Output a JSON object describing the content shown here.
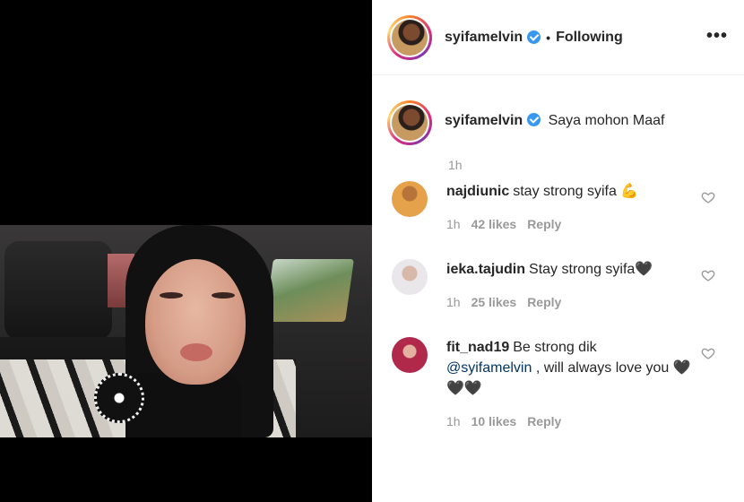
{
  "post": {
    "username": "syifamelvin",
    "follow_status": "Following",
    "separator": "•",
    "more_label": "•••"
  },
  "caption": {
    "username": "syifamelvin",
    "text": "Saya mohon Maaf",
    "time": "1h"
  },
  "comments": [
    {
      "username": "najdiunic",
      "text": "stay strong syifa 💪",
      "time": "1h",
      "likes": "42 likes",
      "reply": "Reply"
    },
    {
      "username": "ieka.tajudin",
      "text": "Stay strong syifa🖤",
      "time": "1h",
      "likes": "25 likes",
      "reply": "Reply"
    },
    {
      "username": "fit_nad19",
      "text_before": "Be strong dik",
      "mention": "@syifamelvin",
      "text_after": ", will always love you 🖤🖤🖤",
      "time": "1h",
      "likes": "10 likes",
      "reply": "Reply"
    }
  ],
  "colors": {
    "verified": "#3897f0",
    "muted": "#999999",
    "text": "#262626"
  },
  "icons": [
    "verified-badge-icon",
    "more-options-icon",
    "heart-icon"
  ]
}
